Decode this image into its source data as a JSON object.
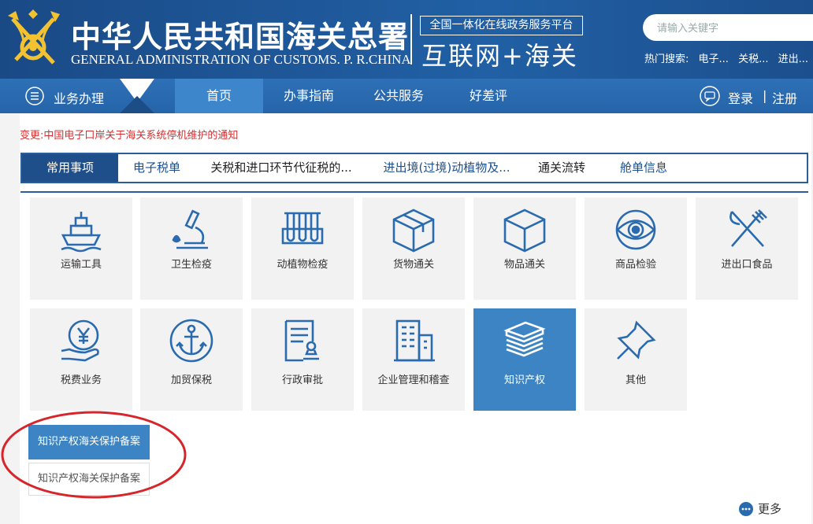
{
  "header": {
    "title_cn": "中华人民共和国海关总署",
    "title_en": "GENERAL ADMINISTRATION OF CUSTOMS. P. R.CHINA",
    "platform_title": "全国一体化在线政务服务平台",
    "platform_sub": "互联网+海关",
    "search_placeholder": "请输入关键字",
    "hot_search_label": "热门搜索:",
    "hot_search_items": [
      "电子...",
      "关税...",
      "进出..."
    ]
  },
  "nav": {
    "business_label": "业务办理",
    "items": [
      "首页",
      "办事指南",
      "公共服务",
      "好差评"
    ],
    "active_item": "首页",
    "login": "登录",
    "separator": "|",
    "register": "注册"
  },
  "notice": "变更:中国电子口岸关于海关系统停机维护的通知",
  "tabs": [
    "常用事项",
    "电子税单",
    "关税和进口环节代征税的...",
    "进出境(过境)动植物及...",
    "通关流转",
    "舱单信息"
  ],
  "tiles": [
    {
      "label": "运输工具",
      "icon": "ship-icon"
    },
    {
      "label": "卫生检疫",
      "icon": "microscope-icon"
    },
    {
      "label": "动植物检疫",
      "icon": "test-tubes-icon"
    },
    {
      "label": "货物通关",
      "icon": "cargo-box-icon"
    },
    {
      "label": "物品通关",
      "icon": "package-cube-icon"
    },
    {
      "label": "商品检验",
      "icon": "eye-icon"
    },
    {
      "label": "进出口食品",
      "icon": "fork-knife-icon"
    },
    {
      "label": "税费业务",
      "icon": "yen-coin-hand-icon"
    },
    {
      "label": "加贸保税",
      "icon": "anchor-icon"
    },
    {
      "label": "行政审批",
      "icon": "document-stamp-icon"
    },
    {
      "label": "企业管理和稽查",
      "icon": "building-icon"
    },
    {
      "label": "知识产权",
      "icon": "books-stack-icon"
    },
    {
      "label": "其他",
      "icon": "pushpin-icon"
    }
  ],
  "active_tile": "知识产权",
  "submenu": {
    "header": "知识产权海关保护备案",
    "items": [
      "知识产权海关保护备案"
    ]
  },
  "more_label": "更多",
  "colors": {
    "header_blue": "#1d4f8c",
    "nav_blue": "#2a6bb0",
    "active_blue": "#3c84c4",
    "notice_red": "#d32f2f",
    "annotation_red": "#d6262b"
  }
}
